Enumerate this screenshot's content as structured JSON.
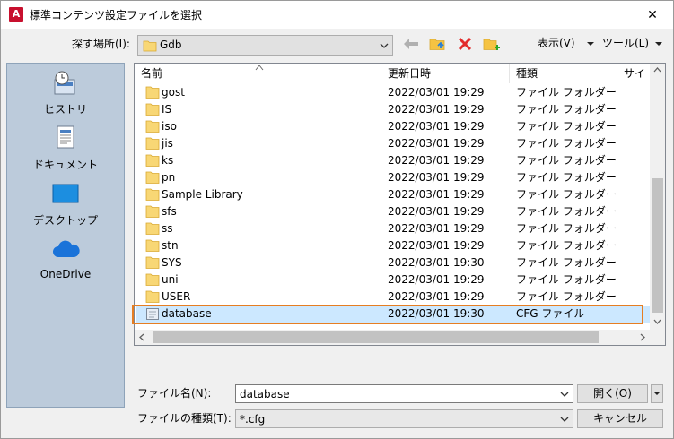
{
  "dialog": {
    "title": "標準コンテンツ設定ファイルを選択",
    "app_icon_letter": "A",
    "close_glyph": "✕"
  },
  "toolbar": {
    "lookin_label": "探す場所(I):",
    "lookin_value": "Gdb",
    "view_label": "表示(V)",
    "tools_label": "ツール(L)",
    "icons": [
      "back-arrow-icon",
      "folder-up-icon",
      "delete-icon",
      "new-folder-icon"
    ]
  },
  "places": [
    {
      "label": "ヒストリ",
      "icon": "history-icon"
    },
    {
      "label": "ドキュメント",
      "icon": "documents-icon"
    },
    {
      "label": "デスクトップ",
      "icon": "desktop-icon"
    },
    {
      "label": "OneDrive",
      "icon": "onedrive-icon"
    }
  ],
  "filelist": {
    "columns": [
      "名前",
      "更新日時",
      "種類",
      "サイズ"
    ],
    "rows": [
      {
        "name": "gost",
        "date": "2022/03/01 19:29",
        "type": "ファイル フォルダー",
        "kind": "folder"
      },
      {
        "name": "IS",
        "date": "2022/03/01 19:29",
        "type": "ファイル フォルダー",
        "kind": "folder"
      },
      {
        "name": "iso",
        "date": "2022/03/01 19:29",
        "type": "ファイル フォルダー",
        "kind": "folder"
      },
      {
        "name": "jis",
        "date": "2022/03/01 19:29",
        "type": "ファイル フォルダー",
        "kind": "folder"
      },
      {
        "name": "ks",
        "date": "2022/03/01 19:29",
        "type": "ファイル フォルダー",
        "kind": "folder"
      },
      {
        "name": "pn",
        "date": "2022/03/01 19:29",
        "type": "ファイル フォルダー",
        "kind": "folder"
      },
      {
        "name": "Sample Library",
        "date": "2022/03/01 19:29",
        "type": "ファイル フォルダー",
        "kind": "folder"
      },
      {
        "name": "sfs",
        "date": "2022/03/01 19:29",
        "type": "ファイル フォルダー",
        "kind": "folder"
      },
      {
        "name": "ss",
        "date": "2022/03/01 19:29",
        "type": "ファイル フォルダー",
        "kind": "folder"
      },
      {
        "name": "stn",
        "date": "2022/03/01 19:29",
        "type": "ファイル フォルダー",
        "kind": "folder"
      },
      {
        "name": "SYS",
        "date": "2022/03/01 19:30",
        "type": "ファイル フォルダー",
        "kind": "folder"
      },
      {
        "name": "uni",
        "date": "2022/03/01 19:29",
        "type": "ファイル フォルダー",
        "kind": "folder"
      },
      {
        "name": "USER",
        "date": "2022/03/01 19:29",
        "type": "ファイル フォルダー",
        "kind": "folder"
      },
      {
        "name": "database",
        "date": "2022/03/01 19:30",
        "type": "CFG ファイル",
        "kind": "file",
        "selected": true
      }
    ]
  },
  "filename": {
    "label": "ファイル名(N):",
    "value": "database"
  },
  "filetype": {
    "label": "ファイルの種類(T):",
    "value": "*.cfg"
  },
  "buttons": {
    "open": "開く(O)",
    "cancel": "キャンセル"
  },
  "colors": {
    "highlight_border": "#e67e22",
    "selected_row": "#cce8ff",
    "places_bg": "#bccbdb"
  }
}
